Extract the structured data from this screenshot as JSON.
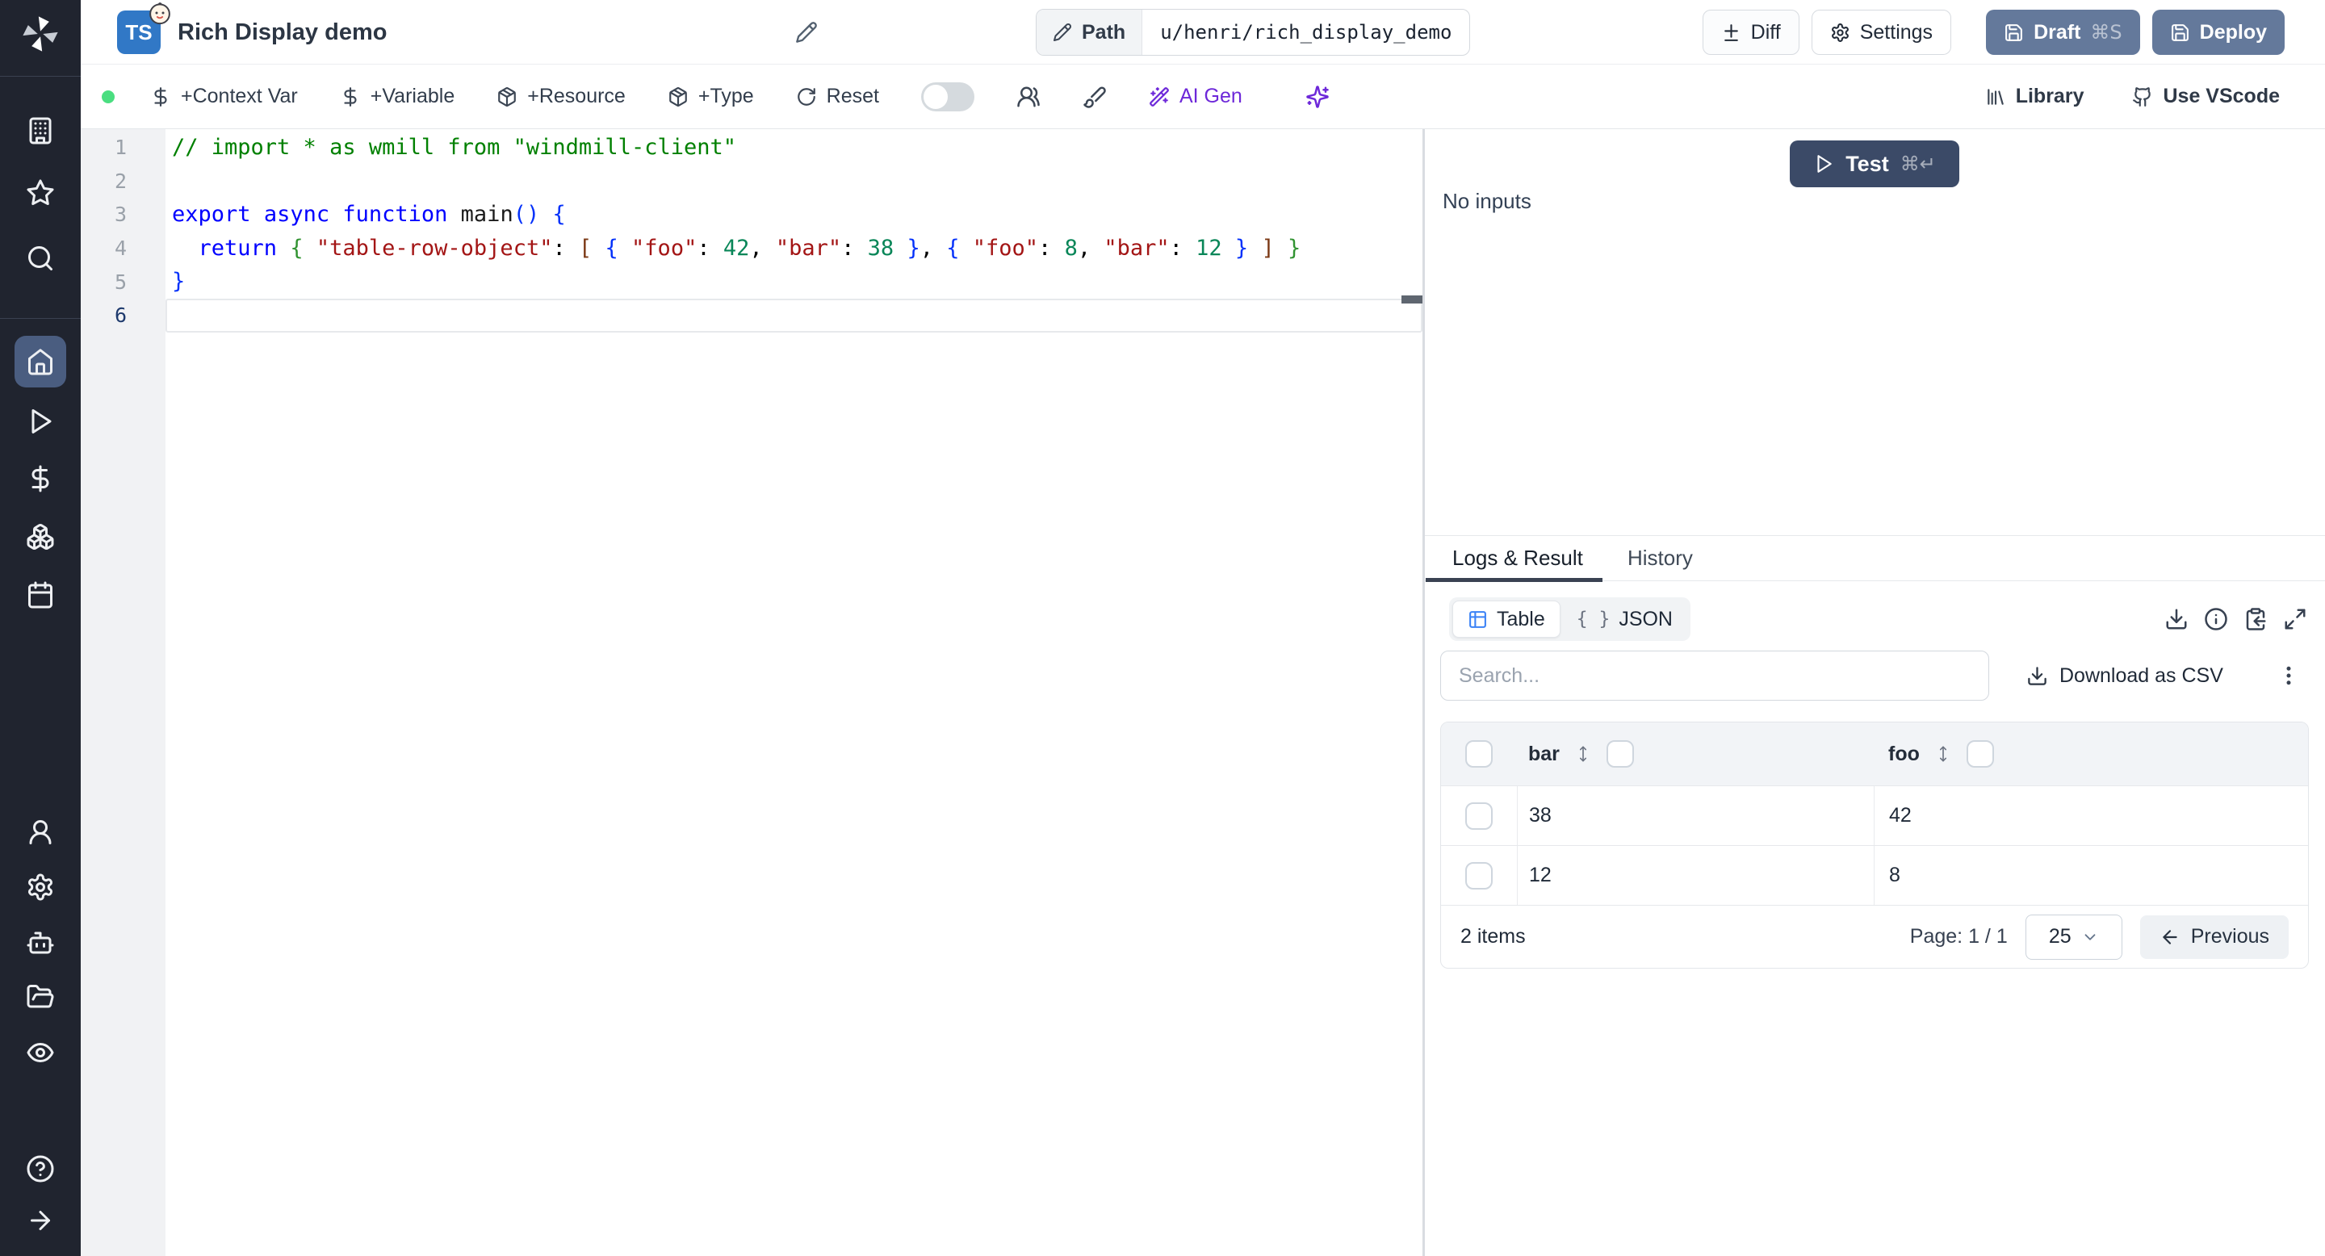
{
  "colors": {
    "sidebar_bg": "#20242f",
    "sidebar_active_bg": "#4a5d80",
    "primary_button_bg": "#64799b",
    "test_button_bg": "#3b4a67",
    "ai_purple": "#6d28d9",
    "status_green_dot": "#4ade80",
    "ts_badge_blue": "#3178c6",
    "table_icon_blue": "#3b82f6",
    "syntax": {
      "comment": "#008000",
      "keyword": "#0000ff",
      "string": "#a31515",
      "number": "#098658",
      "bracket1": "#0431fa",
      "bracket2": "#319331",
      "bracket3": "#7b3814"
    }
  },
  "sidebar": {
    "icons": [
      "windmill-logo",
      "building",
      "star",
      "search",
      "home",
      "play",
      "dollar",
      "boxes",
      "calendar",
      "user",
      "settings",
      "robot",
      "folder-open",
      "eye",
      "help-circle",
      "arrow-right"
    ],
    "active_item": "home"
  },
  "header": {
    "language_badge": "TS",
    "title": "Rich Display demo",
    "path_label": "Path",
    "path_value": "u/henri/rich_display_demo",
    "diff_label": "Diff",
    "settings_label": "Settings",
    "draft_label": "Draft",
    "draft_shortcut": "⌘S",
    "deploy_label": "Deploy"
  },
  "toolbar": {
    "context_var": "+Context Var",
    "variable": "+Variable",
    "resource": "+Resource",
    "type": "+Type",
    "reset": "Reset",
    "ai_gen": "AI Gen",
    "library": "Library",
    "vscode": "Use VScode"
  },
  "editor": {
    "lines": [
      {
        "num": "1",
        "segments": [
          {
            "t": "// import * as wmill from \"windmill-client\"",
            "c": "comment"
          }
        ]
      },
      {
        "num": "2",
        "segments": []
      },
      {
        "num": "3",
        "segments": [
          {
            "t": "export",
            "c": "kw"
          },
          {
            "t": " ",
            "c": "plain"
          },
          {
            "t": "async",
            "c": "kw"
          },
          {
            "t": " ",
            "c": "plain"
          },
          {
            "t": "function",
            "c": "kw"
          },
          {
            "t": " ",
            "c": "plain"
          },
          {
            "t": "main",
            "c": "fn"
          },
          {
            "t": "() {",
            "c": "b1"
          }
        ]
      },
      {
        "num": "4",
        "segments": [
          {
            "t": "  ",
            "c": "plain"
          },
          {
            "t": "return",
            "c": "kw"
          },
          {
            "t": " ",
            "c": "plain"
          },
          {
            "t": "{",
            "c": "b2"
          },
          {
            "t": " ",
            "c": "plain"
          },
          {
            "t": "\"table-row-object\"",
            "c": "str"
          },
          {
            "t": ": ",
            "c": "plain"
          },
          {
            "t": "[",
            "c": "b3"
          },
          {
            "t": " ",
            "c": "plain"
          },
          {
            "t": "{",
            "c": "b1"
          },
          {
            "t": " ",
            "c": "plain"
          },
          {
            "t": "\"foo\"",
            "c": "str"
          },
          {
            "t": ": ",
            "c": "plain"
          },
          {
            "t": "42",
            "c": "num"
          },
          {
            "t": ", ",
            "c": "plain"
          },
          {
            "t": "\"bar\"",
            "c": "str"
          },
          {
            "t": ": ",
            "c": "plain"
          },
          {
            "t": "38",
            "c": "num"
          },
          {
            "t": " ",
            "c": "plain"
          },
          {
            "t": "}",
            "c": "b1"
          },
          {
            "t": ", ",
            "c": "plain"
          },
          {
            "t": "{",
            "c": "b1"
          },
          {
            "t": " ",
            "c": "plain"
          },
          {
            "t": "\"foo\"",
            "c": "str"
          },
          {
            "t": ": ",
            "c": "plain"
          },
          {
            "t": "8",
            "c": "num"
          },
          {
            "t": ", ",
            "c": "plain"
          },
          {
            "t": "\"bar\"",
            "c": "str"
          },
          {
            "t": ": ",
            "c": "plain"
          },
          {
            "t": "12",
            "c": "num"
          },
          {
            "t": " ",
            "c": "plain"
          },
          {
            "t": "}",
            "c": "b1"
          },
          {
            "t": " ",
            "c": "plain"
          },
          {
            "t": "]",
            "c": "b3"
          },
          {
            "t": " ",
            "c": "plain"
          },
          {
            "t": "}",
            "c": "b2"
          }
        ]
      },
      {
        "num": "5",
        "segments": [
          {
            "t": "}",
            "c": "b1"
          }
        ]
      },
      {
        "num": "6",
        "segments": [],
        "current": true
      }
    ]
  },
  "runner": {
    "test_label": "Test",
    "test_shortcut": "⌘↵",
    "no_inputs": "No inputs"
  },
  "result_panel": {
    "tabs": {
      "logs": "Logs & Result",
      "history": "History"
    },
    "view_toggle": {
      "table": "Table",
      "json": "JSON",
      "json_icon_glyph": "{ }"
    },
    "search_placeholder": "Search...",
    "download_csv": "Download as CSV",
    "table": {
      "columns": [
        "bar",
        "foo"
      ],
      "rows": [
        {
          "bar": "38",
          "foo": "42"
        },
        {
          "bar": "12",
          "foo": "8"
        }
      ],
      "items_text": "2 items",
      "page_text": "Page: 1 / 1",
      "page_size": "25",
      "previous_label": "Previous"
    }
  }
}
